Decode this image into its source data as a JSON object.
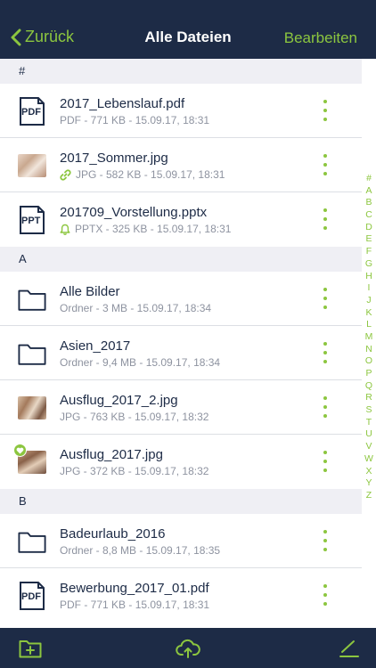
{
  "nav": {
    "back_label": "Zurück",
    "title": "Alle Dateien",
    "edit_label": "Bearbeiten"
  },
  "colors": {
    "accent": "#8cc63f",
    "navy": "#1d2b46",
    "meta_gray": "#8e93a0",
    "section_bg": "#efeff4"
  },
  "sections": [
    {
      "header": "#",
      "items": [
        {
          "name": "2017_Lebenslauf.pdf",
          "meta": "PDF - 771 KB - 15.09.17, 18:31",
          "icon": "pdf-file-icon"
        },
        {
          "name": "2017_Sommer.jpg",
          "meta": "JPG - 582 KB - 15.09.17, 18:31",
          "icon": "photo-thumbnail",
          "status_icon": "link-icon"
        },
        {
          "name": "201709_Vorstellung.pptx",
          "meta": "PPTX - 325 KB - 15.09.17, 18:31",
          "icon": "ppt-file-icon",
          "status_icon": "bell-icon"
        }
      ]
    },
    {
      "header": "A",
      "items": [
        {
          "name": "Alle Bilder",
          "meta": "Ordner - 3 MB - 15.09.17, 18:34",
          "icon": "folder-icon"
        },
        {
          "name": "Asien_2017",
          "meta": "Ordner - 9,4 MB - 15.09.17, 18:34",
          "icon": "folder-icon"
        },
        {
          "name": "Ausflug_2017_2.jpg",
          "meta": "JPG - 763 KB - 15.09.17, 18:32",
          "icon": "photo-thumbnail"
        },
        {
          "name": "Ausflug_2017.jpg",
          "meta": "JPG - 372 KB - 15.09.17, 18:32",
          "icon": "photo-thumbnail",
          "badge": "favorite-heart-icon"
        }
      ]
    },
    {
      "header": "B",
      "items": [
        {
          "name": "Badeurlaub_2016",
          "meta": "Ordner - 8,8 MB - 15.09.17, 18:35",
          "icon": "folder-icon"
        },
        {
          "name": "Bewerbung_2017_01.pdf",
          "meta": "PDF - 771 KB - 15.09.17, 18:31",
          "icon": "pdf-file-icon"
        }
      ]
    }
  ],
  "index_letters": [
    "#",
    "A",
    "B",
    "C",
    "D",
    "E",
    "F",
    "G",
    "H",
    "I",
    "J",
    "K",
    "L",
    "M",
    "N",
    "O",
    "P",
    "Q",
    "R",
    "S",
    "T",
    "U",
    "V",
    "W",
    "X",
    "Y",
    "Z"
  ],
  "toolbar": {
    "icons": [
      "new-folder-icon",
      "upload-cloud-icon",
      "edit-pencil-icon"
    ]
  }
}
